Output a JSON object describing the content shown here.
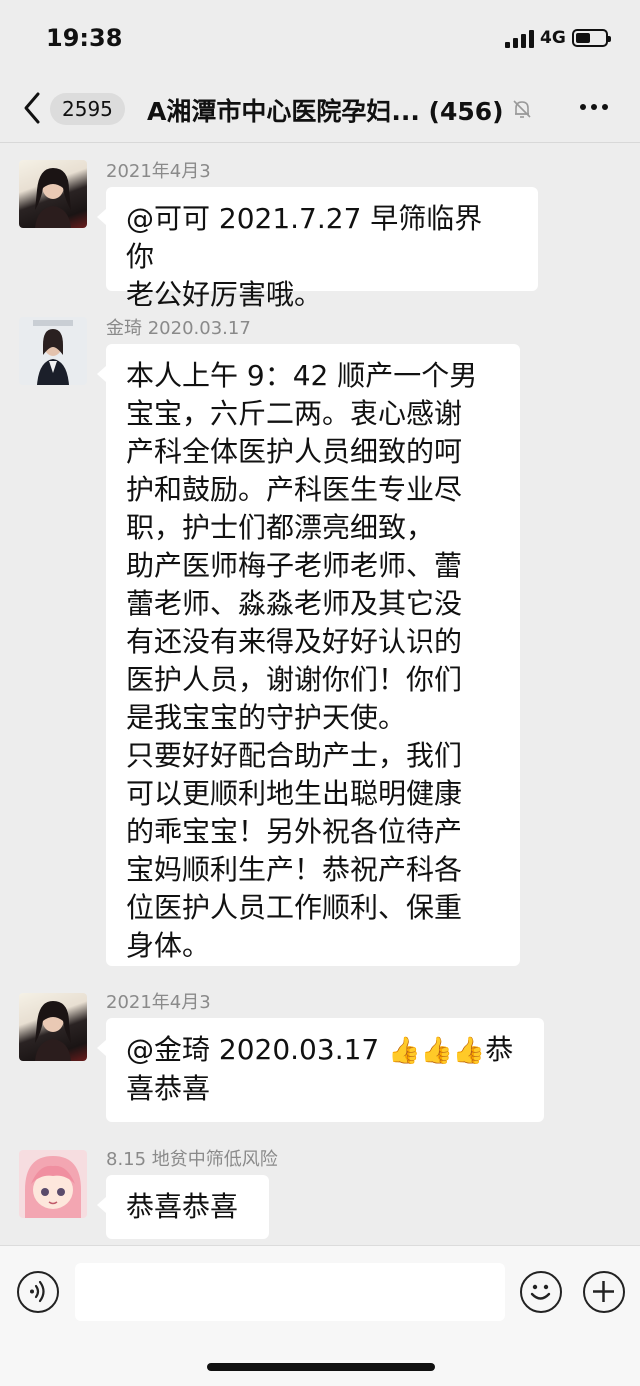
{
  "status_bar": {
    "time": "19:38",
    "network": "4G"
  },
  "nav": {
    "back_icon": "chevron-left-icon",
    "unread_count": "2595",
    "title": "A湘潭市中心医院孕妇... (456)",
    "mute_icon": "bell-off-icon",
    "more_icon": "more-dots-icon"
  },
  "messages": [
    {
      "sender": "2021年4月3",
      "text": "@可可 2021.7.27 早筛临界 你\n老公好厉害哦。"
    },
    {
      "sender": "金琦 2020.03.17",
      "text": "本人上午 9：42 顺产一个男\n宝宝，六斤二两。衷心感谢\n产科全体医护人员细致的呵\n护和鼓励。产科医生专业尽\n职，护士们都漂亮细致，\n助产医师梅子老师老师、蕾\n蕾老师、淼淼老师及其它没\n有还没有来得及好好认识的\n医护人员，谢谢你们！你们\n是我宝宝的守护天使。\n只要好好配合助产士，我们\n可以更顺利地生出聪明健康\n的乖宝宝！另外祝各位待产\n宝妈顺利生产！恭祝产科各\n位医护人员工作顺利、保重\n身体。"
    },
    {
      "sender": "2021年4月3",
      "text_before": "@金琦 2020.03.17 ",
      "thumbs": "👍👍👍",
      "text_after": "恭\n喜恭喜"
    },
    {
      "sender": "8.15 地贫中筛低风险",
      "text": "恭喜恭喜"
    }
  ],
  "input_bar": {
    "voice_icon": "voice-icon",
    "emoji_icon": "emoji-icon",
    "plus_icon": "plus-icon"
  }
}
